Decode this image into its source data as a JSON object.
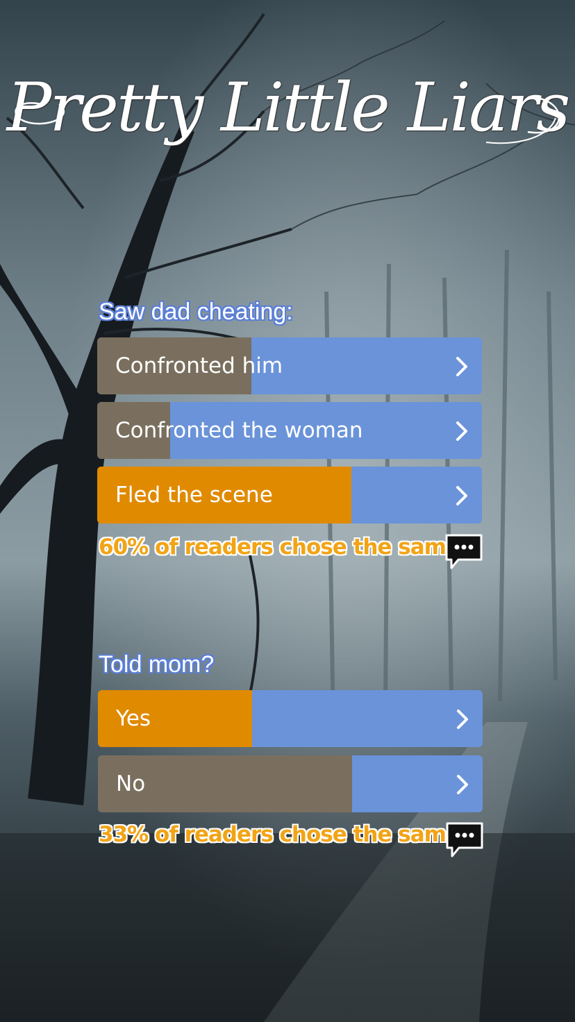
{
  "app": {
    "logo_text": "Pretty Little Liars"
  },
  "colors": {
    "option_bar": "#6a93d9",
    "vote_fill": "#7a6f5e",
    "selected_fill": "#e08a00",
    "result_text": "#f2a416"
  },
  "icons": {
    "chevron": "chevron-right-icon",
    "comment": "comment-bubble-icon"
  },
  "questions": [
    {
      "title": "Saw dad cheating:",
      "options": [
        {
          "label": "Confronted him",
          "percent": 40,
          "selected": false
        },
        {
          "label": "Confronted the woman",
          "percent": 19,
          "selected": false
        },
        {
          "label": "Fled the scene",
          "percent": 66,
          "selected": true
        }
      ],
      "result": "60% of readers chose the same"
    },
    {
      "title": "Told mom?",
      "options": [
        {
          "label": "Yes",
          "percent": 40,
          "selected": true
        },
        {
          "label": "No",
          "percent": 66,
          "selected": false
        }
      ],
      "result": "33% of readers chose the same"
    }
  ]
}
